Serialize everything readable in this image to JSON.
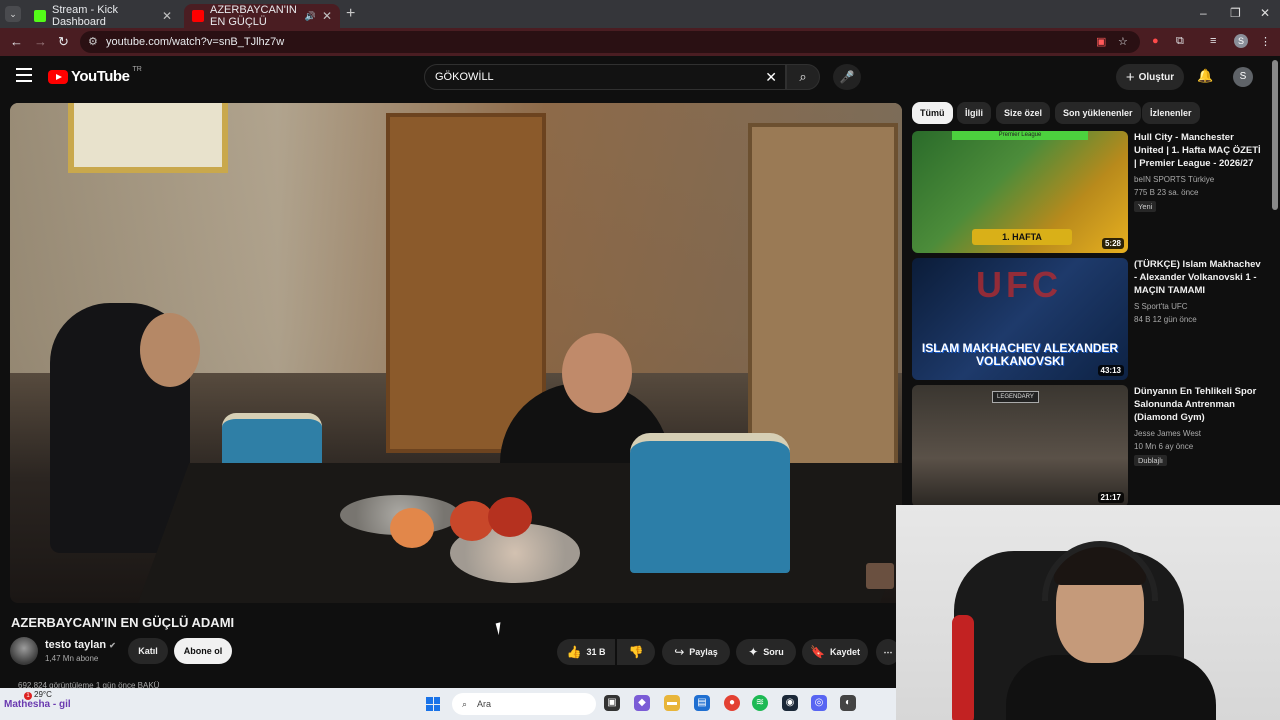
{
  "browser": {
    "tabs": [
      {
        "label": "Stream - Kick Dashboard",
        "icon": "kick-icon",
        "color": "#53fc18"
      },
      {
        "label": "AZERBAYCAN'IN EN GÜÇLÜ",
        "icon": "youtube-icon",
        "color": "#ff0000",
        "active": true
      }
    ],
    "url": "youtube.com/watch?v=snB_TJlhz7w",
    "profile_initial": "S"
  },
  "youtube": {
    "logo_text": "YouTube",
    "logo_suffix": "TR",
    "search_query": "GÖKOWİLL",
    "create_label": "Oluştur",
    "avatar_initial": "S"
  },
  "video": {
    "title": "AZERBAYCAN'IN EN GÜÇLÜ ADAMI",
    "channel": "testo taylan",
    "subscribers": "1,47 Mn abone",
    "join_label": "Katıl",
    "subscribe_label": "Abone ol",
    "likes": "31 B",
    "share_label": "Paylaş",
    "ask_label": "Soru",
    "save_label": "Kaydet",
    "views_line": "692.824 görüntüleme  1 gün önce  BAKÜ"
  },
  "sidebar": {
    "chips": [
      "Tümü",
      "İlgili",
      "Size özel",
      "Son yüklenenler",
      "İzlenenler"
    ],
    "recommendations": [
      {
        "title": "Hull City - Manchester United | 1. Hafta MAÇ ÖZETİ | Premier League - 2026/27",
        "channel": "beIN SPORTS Türkiye",
        "meta": "775 B  23 sa. önce",
        "badge": "Yeni",
        "duration": "5:28",
        "thumb_league": "Premier League",
        "thumb_text": "1. HAFTA"
      },
      {
        "title": "(TÜRKÇE) Islam Makhachev - Alexander Volkanovski 1 - MAÇIN TAMAMI",
        "channel": "S Sport'ta UFC",
        "meta": "84 B  12 gün önce",
        "badge": "",
        "duration": "43:13",
        "thumb_text": "ISLAM MAKHACHEV ALEXANDER VOLKANOVSKI",
        "thumb_logo": "UFC"
      },
      {
        "title": "Dünyanın En Tehlikeli Spor Salonunda Antrenman (Diamond Gym)",
        "channel": "Jesse James West",
        "meta": "10 Mn  6 ay önce",
        "badge": "Dublajlı",
        "duration": "21:17",
        "thumb_text": "LEGENDARY"
      }
    ]
  },
  "taskbar": {
    "temperature": "29°C",
    "ticker": "Mathesha - gil",
    "notification_count": "1",
    "search_placeholder": "Ara"
  }
}
